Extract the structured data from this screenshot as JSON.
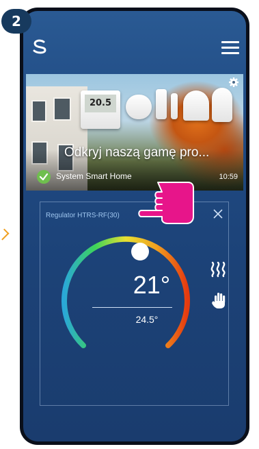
{
  "step_badge": "2",
  "app": {
    "logo": "salus-logo-icon",
    "menu": "hamburger-menu-icon"
  },
  "banner": {
    "title": "Odkryj naszą gamę pro...",
    "thermostat_display": "20.5",
    "status": "System Smart Home",
    "time": "10:59",
    "settings_icon": "gear-icon"
  },
  "device_card": {
    "title": "Regulator HTRS-RF(30)",
    "set_temperature": "21°",
    "current_temperature": "24.5°",
    "mode_icons": [
      "heating-icon",
      "manual-hand-icon"
    ],
    "dial_colors": [
      "#2aa8d8",
      "#3dd45a",
      "#e8e032",
      "#f0a020",
      "#e53a10"
    ]
  },
  "colors": {
    "screen_bg": "#204b84",
    "accent_label": "#9fc6ef",
    "badge": "#173a5e"
  }
}
